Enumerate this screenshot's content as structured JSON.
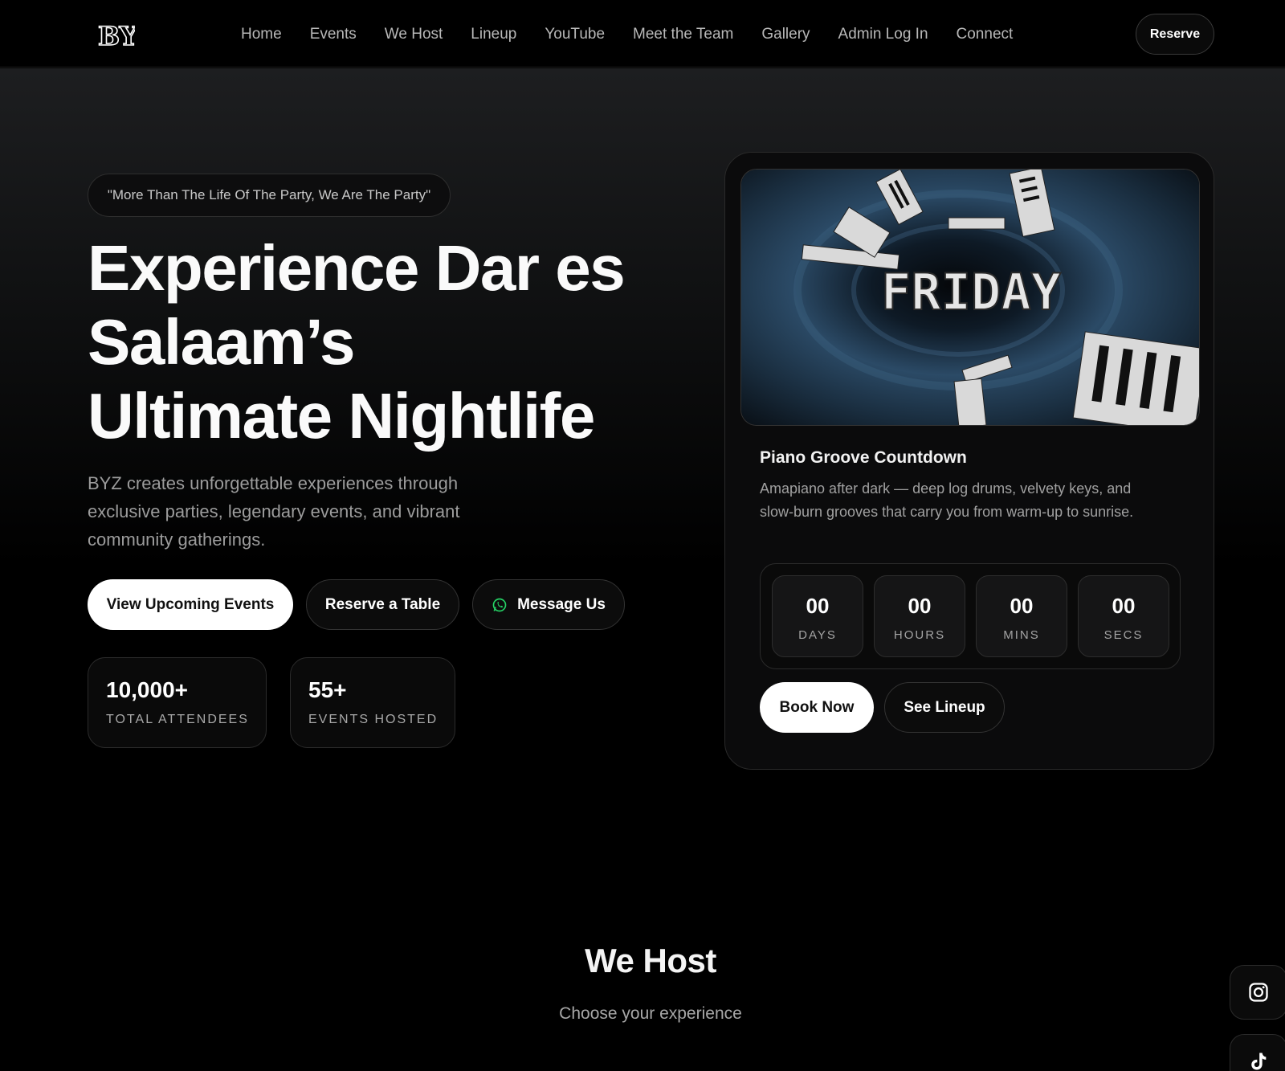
{
  "nav": {
    "logo_text": "BYZ",
    "links": [
      "Home",
      "Events",
      "We Host",
      "Lineup",
      "YouTube",
      "Meet the Team",
      "Gallery",
      "Admin Log In",
      "Connect"
    ],
    "reserve_label": "Reserve"
  },
  "hero": {
    "quote": "\"More Than The Life Of The Party, We Are The Party\"",
    "title_line1": "Experience Dar es",
    "title_line2": "Salaam’s",
    "title_line3": "Ultimate Nightlife",
    "description": "BYZ creates unforgettable experiences through exclusive parties, legendary events, and vibrant community gatherings.",
    "buttons": {
      "primary": "View Upcoming Events",
      "secondary": "Reserve a Table",
      "message": "Message Us"
    },
    "stats": [
      {
        "value": "10,000+",
        "label": "TOTAL ATTENDEES"
      },
      {
        "value": "55+",
        "label": "EVENTS HOSTED"
      }
    ]
  },
  "event_card": {
    "poster_text": "FRIDAY",
    "title": "Piano Groove Countdown",
    "description": "Amapiano after dark — deep log drums, velvety keys, and slow-burn grooves that carry you from warm-up to sunrise.",
    "countdown": [
      {
        "value": "00",
        "label": "DAYS"
      },
      {
        "value": "00",
        "label": "HOURS"
      },
      {
        "value": "00",
        "label": "MINS"
      },
      {
        "value": "00",
        "label": "SECS"
      }
    ],
    "book_label": "Book Now",
    "lineup_label": "See Lineup"
  },
  "section": {
    "title": "We Host",
    "subtitle": "Choose your experience"
  },
  "social": {
    "icons": [
      "instagram-icon",
      "tiktok-icon"
    ]
  },
  "colors": {
    "background": "#000000",
    "accent_white": "#ffffff",
    "whatsapp_green": "#25d366"
  }
}
